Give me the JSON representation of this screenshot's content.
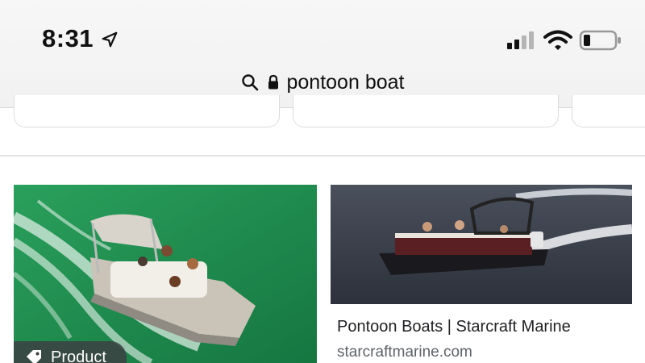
{
  "status_bar": {
    "time": "8:31",
    "icons": [
      "location-arrow-icon",
      "cellular-signal-icon",
      "wifi-icon",
      "battery-icon"
    ]
  },
  "search": {
    "query": "pontoon boat",
    "icons": [
      "search-icon",
      "lock-icon"
    ]
  },
  "results": [
    {
      "badge": "Product",
      "badge_icon": "tag-icon",
      "image": "pontoon boat cruising on green water"
    },
    {
      "title": "Pontoon Boats | Starcraft Marine",
      "source": "starcraftmarine.com",
      "image": "dark pontoon boat on water"
    }
  ],
  "colors": {
    "header_bg": "#f3f3f3",
    "text": "#202124",
    "source_text": "#5f6368",
    "green_water": "#1f8a4f"
  }
}
